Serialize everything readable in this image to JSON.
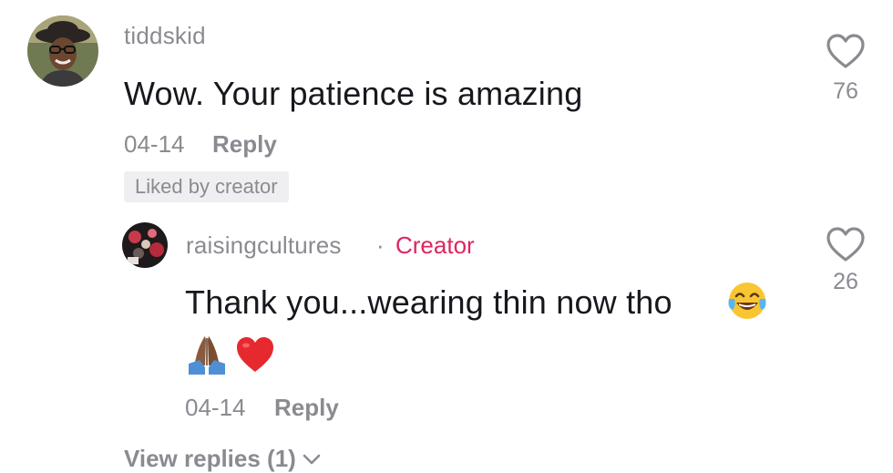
{
  "comment": {
    "username": "tiddskid",
    "text": "Wow. Your patience is amazing",
    "date": "04-14",
    "reply_label": "Reply",
    "liked_badge": "Liked by creator",
    "like_count": "76"
  },
  "reply": {
    "username": "raisingcultures",
    "separator": "·",
    "creator_label": "Creator",
    "text": "Thank you...wearing thin now tho",
    "emojis": [
      "face-with-tears-of-joy-icon",
      "folded-hands-icon",
      "red-heart-icon"
    ],
    "date": "04-14",
    "reply_label": "Reply",
    "like_count": "26"
  },
  "view_replies_label": "View replies (1)",
  "colors": {
    "meta_gray": "#8a8b91",
    "text_dark": "#16181d",
    "creator_red": "#e0245e",
    "badge_bg": "#efeff1"
  }
}
